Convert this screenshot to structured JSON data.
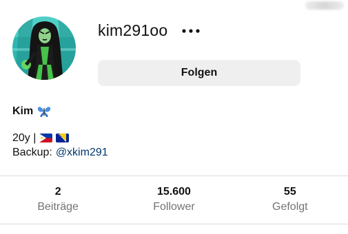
{
  "profile": {
    "username": "kim291oo",
    "follow_label": "Folgen",
    "more_icon": "more-horizontal-icon",
    "display_name": "Kim",
    "name_emoji": "butterfly-icon",
    "avatar_icon": "avatar-cartoon-character"
  },
  "bio": {
    "line1_text": "20y |",
    "line1_flags": [
      "philippines-flag-icon",
      "bosnia-flag-icon"
    ],
    "backup_prefix": "Backup:",
    "backup_handle": "@xkim291"
  },
  "stats": [
    {
      "value": "2",
      "label": "Beiträge"
    },
    {
      "value": "15.600",
      "label": "Follower"
    },
    {
      "value": "55",
      "label": "Gefolgt"
    }
  ],
  "colors": {
    "link": "#00376b",
    "button_bg": "#efefef",
    "muted_text": "#737373",
    "divider": "#dbdbdb"
  }
}
